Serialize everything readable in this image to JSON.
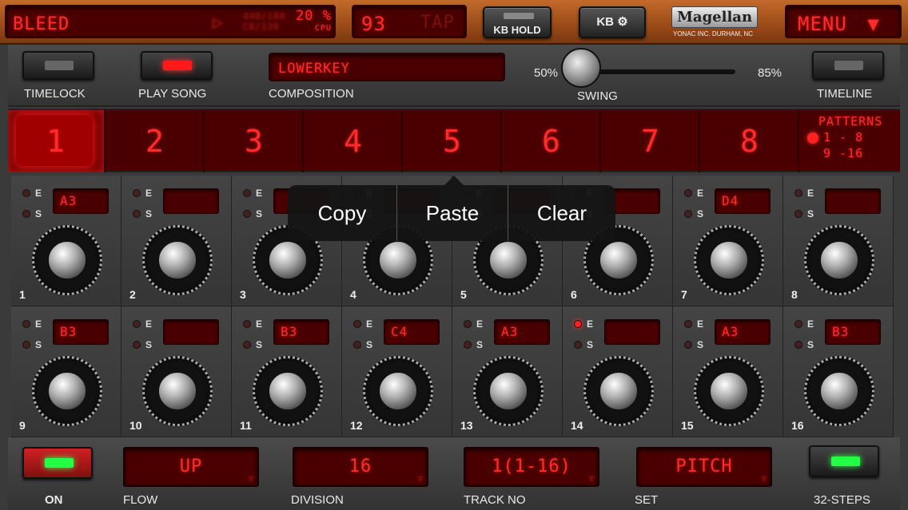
{
  "top": {
    "preset_name": "BLEED",
    "play_symbol": "▷",
    "rate_line1": "448/180",
    "rate_line2": "CB/130",
    "cpu_value": "20 %",
    "cpu_label": "CPU",
    "tempo": "93",
    "tap_label": "TAP",
    "kb_hold_label": "KB HOLD",
    "kb_settings_label": "KB",
    "brand": "Magellan",
    "brand_sub": "YONAC INC. DURHAM, NC",
    "menu_label": "MENU",
    "menu_arrow": "▼"
  },
  "controls": {
    "timelock_label": "TIMELOCK",
    "play_song_label": "PLAY SONG",
    "composition_value": "LOWERKEY",
    "composition_label": "COMPOSITION",
    "swing_min": "50%",
    "swing_max": "85%",
    "swing_label": "SWING",
    "swing_level": 0.0,
    "timeline_label": "TIMELINE"
  },
  "patterns": {
    "items": [
      "1",
      "2",
      "3",
      "4",
      "5",
      "6",
      "7",
      "8"
    ],
    "selected": "1",
    "label": "PATTERNS",
    "range1": "1 - 8",
    "range2": "9 -16"
  },
  "steps": [
    {
      "n": "1",
      "note": "A3",
      "e_on": false
    },
    {
      "n": "2",
      "note": "",
      "e_on": false
    },
    {
      "n": "3",
      "note": "",
      "e_on": false
    },
    {
      "n": "4",
      "note": "",
      "e_on": false
    },
    {
      "n": "5",
      "note": "",
      "e_on": false
    },
    {
      "n": "6",
      "note": "",
      "e_on": false
    },
    {
      "n": "7",
      "note": "D4",
      "e_on": false
    },
    {
      "n": "8",
      "note": "",
      "e_on": false
    },
    {
      "n": "9",
      "note": "B3",
      "e_on": false
    },
    {
      "n": "10",
      "note": "",
      "e_on": false
    },
    {
      "n": "11",
      "note": "B3",
      "e_on": false
    },
    {
      "n": "12",
      "note": "C4",
      "e_on": false
    },
    {
      "n": "13",
      "note": "A3",
      "e_on": false
    },
    {
      "n": "14",
      "note": "",
      "e_on": true
    },
    {
      "n": "15",
      "note": "A3",
      "e_on": false
    },
    {
      "n": "16",
      "note": "B3",
      "e_on": false
    }
  ],
  "es_labels": {
    "e": "E",
    "s": "S"
  },
  "popup": {
    "copy": "Copy",
    "paste": "Paste",
    "clear": "Clear"
  },
  "bottom": {
    "on_label": "ON",
    "flow_value": "UP",
    "flow_label": "FLOW",
    "division_value": "16",
    "division_label": "DIVISION",
    "track_value": "1(1-16)",
    "track_label": "TRACK NO",
    "set_value": "PITCH",
    "set_label": "SET",
    "steps_label": "32-STEPS",
    "dropdown_symbol": "▽"
  },
  "colors": {
    "led_red": "#ff2a2a",
    "lcd_bg": "#4a0000",
    "lamp_green": "#22ff44",
    "wood": "#b0581f"
  }
}
